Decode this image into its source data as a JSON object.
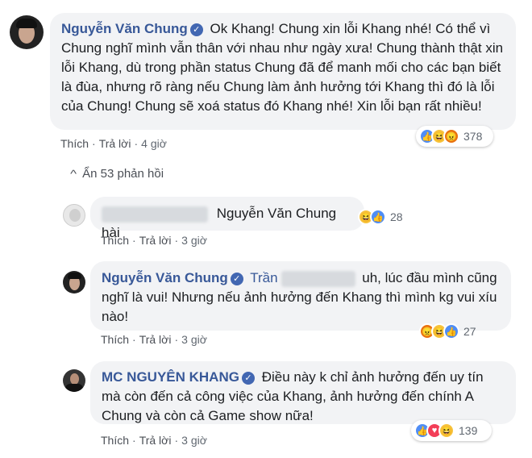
{
  "comments": [
    {
      "author": "Nguyễn Văn Chung",
      "text": "Ok Khang! Chung xin lỗi Khang nhé! Có thể vì Chung nghĩ mình vẫn thân với nhau như ngày xưa! Chung thành thật xin lỗi Khang, dù trong phần status Chung đã để manh mối cho các bạn biết là đùa, nhưng rõ ràng nếu Chung làm ảnh hưởng tới Khang thì đó là lỗi của Chung! Chung sẽ xoá status đó Khang nhé! Xin lỗi bạn rất nhiều!",
      "like": "Thích",
      "reply": "Trả lời",
      "time": "4 giờ",
      "reaction_count": "378",
      "reactions": [
        "like-icon",
        "haha-icon",
        "angry-icon"
      ]
    }
  ],
  "hide_replies": "Ẩn 53 phản hồi",
  "replies": [
    {
      "text": "Nguyễn Văn Chung hài",
      "like": "Thích",
      "reply": "Trả lời",
      "time": "3 giờ",
      "reaction_count": "28",
      "reactions": [
        "haha-icon",
        "like-icon"
      ]
    },
    {
      "author": "Nguyễn Văn Chung",
      "mention": "Trần",
      "text_1": "uh, lúc đầu mình",
      "text_2": "cũng nghĩ là vui! Nhưng nếu ảnh hưởng đến Khang thì mình kg vui xíu nào!",
      "like": "Thích",
      "reply": "Trả lời",
      "time": "3 giờ",
      "reaction_count": "27",
      "reactions": [
        "angry-icon",
        "haha-icon",
        "like-icon"
      ]
    },
    {
      "author": "MC NGUYÊN KHANG",
      "text": "Điều này k chỉ ảnh hưởng đến uy tín mà còn đến cả công việc của Khang, ảnh hưởng đến chính A Chung và còn cả Game show nữa!",
      "like": "Thích",
      "reply": "Trả lời",
      "time": "3 giờ",
      "reaction_count": "139",
      "reactions": [
        "like-icon",
        "love-icon",
        "haha-icon"
      ]
    }
  ],
  "colors": {
    "name": "#385898",
    "bubble": "#f2f3f5",
    "like": "#4f8df5",
    "haha": "#f7c33c",
    "angry": "#e9710f",
    "love": "#f33e58"
  }
}
